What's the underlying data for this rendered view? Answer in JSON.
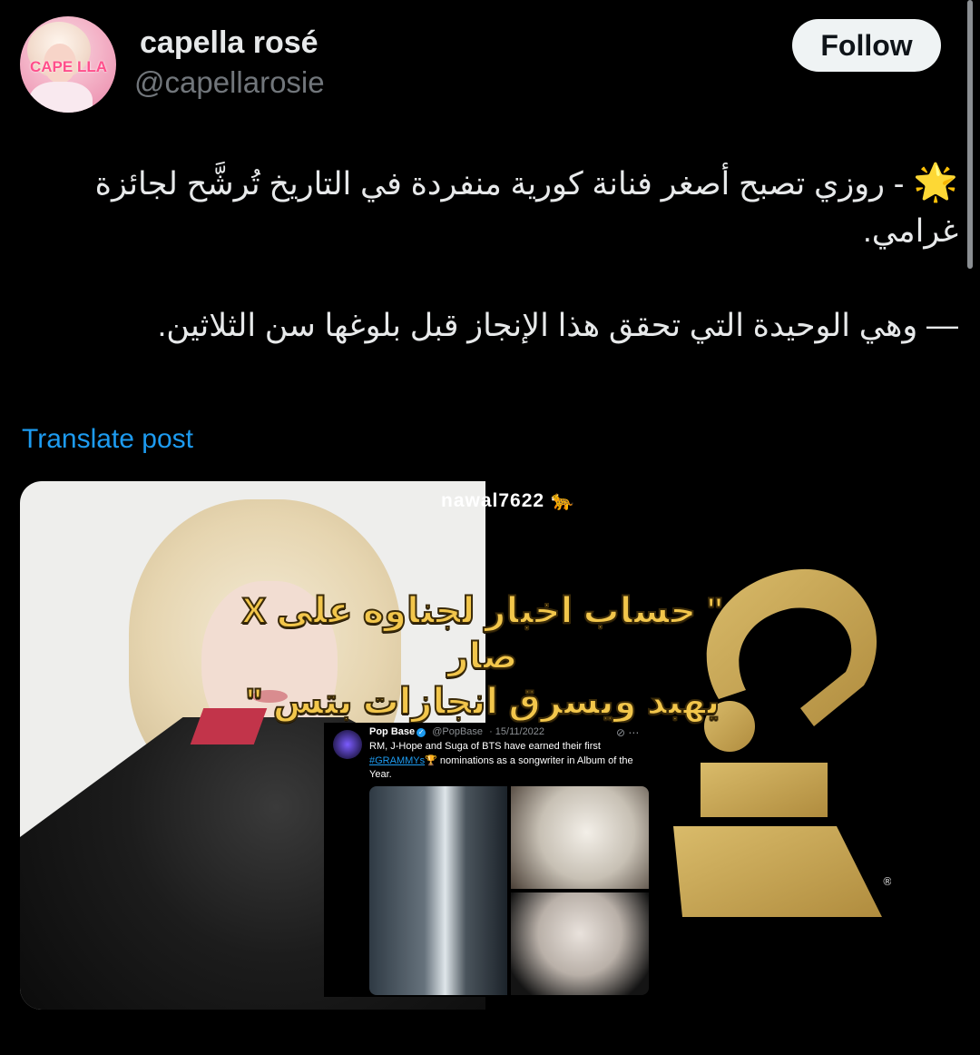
{
  "user": {
    "display_name": "capella rosé",
    "handle": "@capellarosie",
    "avatar_logo": "CAPE LLA"
  },
  "follow_label": "Follow",
  "post": {
    "emoji": "🌟",
    "line1": "- روزي تصبح أصغر فنانة كورية منفردة في التاريخ تُرشَّح لجائزة غرامي.",
    "line2": "— وهي الوحيدة التي تحقق هذا الإنجاز قبل بلوغها سن الثلاثين."
  },
  "translate_label": "Translate post",
  "media": {
    "watermark": "nawal7622 🐆",
    "overlay_line1": "\" حساب اخبار لجناوه على X صار",
    "overlay_line2": "يهبد ويسرق انجازات بتس \"",
    "embedded_tweet": {
      "name": "Pop Base",
      "handle": "@PopBase",
      "date": "· 15/11/2022",
      "text_before": "RM, J-Hope and Suga of BTS have earned their first",
      "hashtag": "#GRAMMYs",
      "text_after": "🏆 nominations as a songwriter in Album of the Year."
    }
  },
  "colors": {
    "background": "#000000",
    "link": "#1d9bf0",
    "overlay_text": "#f2c64b",
    "grammy_gold": "#c9a655"
  }
}
